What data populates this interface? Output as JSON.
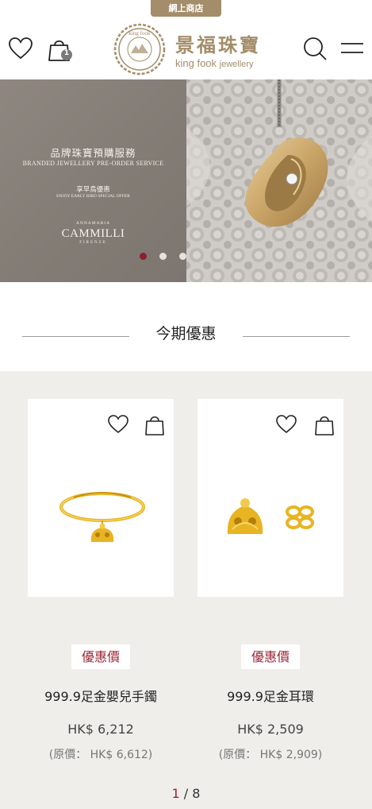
{
  "top_tab": {
    "label": "網上商店"
  },
  "header": {
    "cart_count": "1",
    "logo": {
      "zh": "景福珠寶",
      "en_brand": "king fook",
      "en_suffix": "jewellery",
      "seal_text": "king fook"
    }
  },
  "banner": {
    "title_zh": "品牌珠寶預購服務",
    "title_en": "BRANDED JEWELLERY PRE-ORDER SERVICE",
    "subtitle_zh": "享早鳥優惠",
    "subtitle_en": "ENJOY EARLY BIRD SPECIAL OFFER",
    "brand_top": "ANNAMARIA",
    "brand": "CAMMILLI",
    "brand_bottom": "FIRENZE",
    "slides": 3,
    "active_slide": 1
  },
  "section": {
    "title": "今期優惠"
  },
  "products": [
    {
      "badge": "優惠價",
      "name": "999.9足金嬰兒手鐲",
      "price": "HK$ 6,212",
      "original_price": "(原價： HK$ 6,612)"
    },
    {
      "badge": "優惠價",
      "name": "999.9足金耳環",
      "price": "HK$ 2,509",
      "original_price": "(原價： HK$ 2,909)"
    }
  ],
  "pager": {
    "current": "1",
    "separator": " / ",
    "total": "8"
  },
  "colors": {
    "gold": "#a48d6a",
    "accent_red": "#9b2335",
    "grey_bg": "#f0eeea",
    "jewel_gold": "#e8b422"
  }
}
